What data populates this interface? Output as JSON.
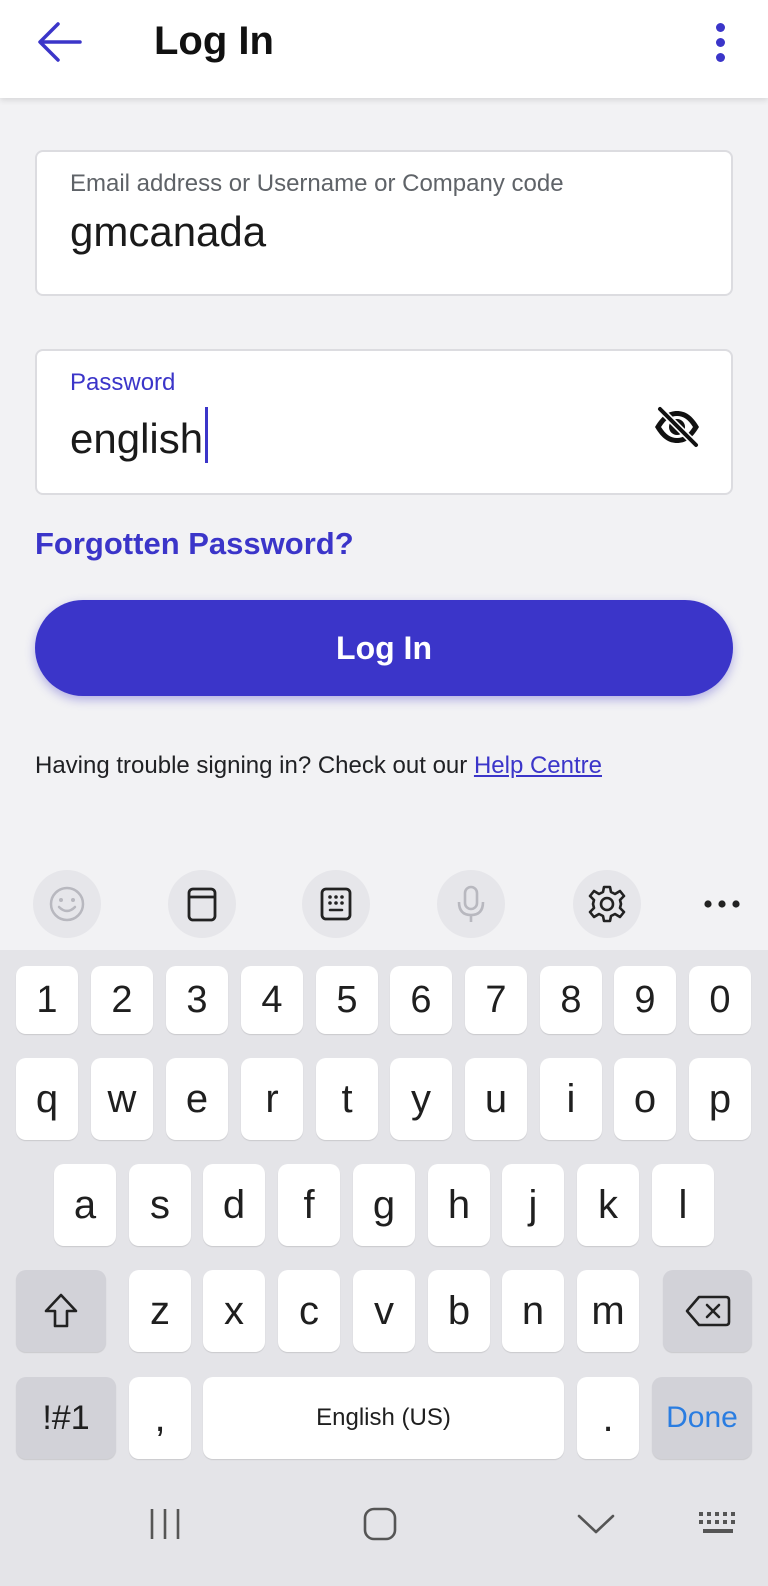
{
  "appbar": {
    "title": "Log In",
    "back_icon": "arrow-left-icon",
    "menu_icon": "more-vertical-icon",
    "accent": "#3b35c9"
  },
  "form": {
    "email": {
      "label": "Email address or Username or Company code",
      "value": "gmcanada"
    },
    "password": {
      "label": "Password",
      "value": "english",
      "toggle_icon": "eye-off-icon"
    },
    "forgot_label": "Forgotten Password?",
    "login_label": "Log In",
    "help_text": "Having trouble signing in? Check out our ",
    "help_link": "Help Centre"
  },
  "keyboard": {
    "toolbar": [
      "emoji-icon",
      "clipboard-icon",
      "keypad-icon",
      "microphone-icon",
      "settings-icon",
      "more-horizontal-icon"
    ],
    "row_numbers": [
      "1",
      "2",
      "3",
      "4",
      "5",
      "6",
      "7",
      "8",
      "9",
      "0"
    ],
    "row_top": [
      "q",
      "w",
      "e",
      "r",
      "t",
      "y",
      "u",
      "i",
      "o",
      "p"
    ],
    "row_home": [
      "a",
      "s",
      "d",
      "f",
      "g",
      "h",
      "j",
      "k",
      "l"
    ],
    "row_bottom": [
      "z",
      "x",
      "c",
      "v",
      "b",
      "n",
      "m"
    ],
    "symbols_label": "!#1",
    "comma_label": ",",
    "space_label": "English (US)",
    "period_label": ".",
    "done_label": "Done",
    "done_color": "#2a7de1"
  },
  "navbar": {
    "items": [
      "recent-apps-icon",
      "home-icon",
      "hide-keyboard-icon",
      "keyboard-switch-icon"
    ]
  }
}
